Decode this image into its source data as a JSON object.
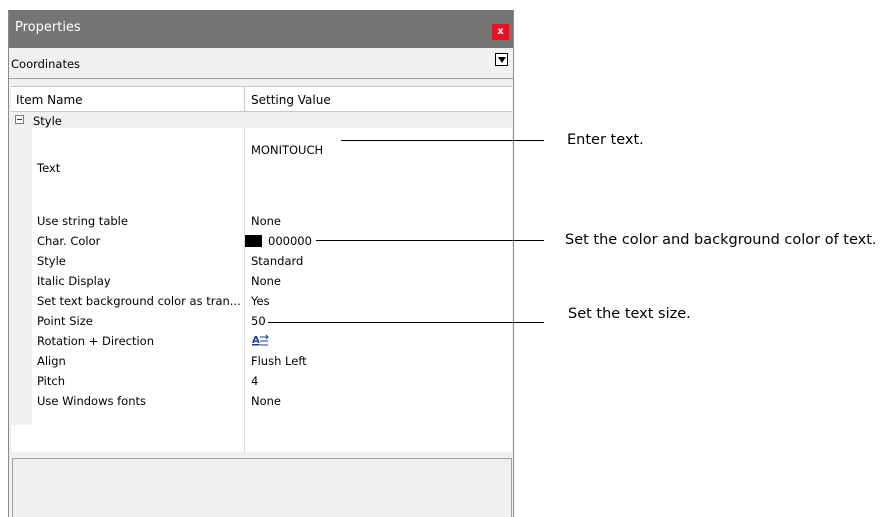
{
  "window": {
    "title": "Properties",
    "close_label": "x",
    "selector": "Coordinates"
  },
  "grid": {
    "headers": [
      "Item Name",
      "Setting Value"
    ],
    "category": "Style",
    "rows": [
      {
        "name": "Text",
        "value": "MONITOUCH"
      },
      {
        "name": "Use string table",
        "value": "None"
      },
      {
        "name": "Char. Color",
        "value": "000000",
        "swatch": "#000000"
      },
      {
        "name": "Style",
        "value": "Standard"
      },
      {
        "name": "Italic Display",
        "value": "None"
      },
      {
        "name": "Set text background color as tran...",
        "value": "Yes"
      },
      {
        "name": "Point Size",
        "value": "50"
      },
      {
        "name": "Rotation + Direction",
        "value": "",
        "icon": "text-direction-icon"
      },
      {
        "name": "Align",
        "value": "Flush Left"
      },
      {
        "name": "Pitch",
        "value": "4"
      },
      {
        "name": "Use Windows fonts",
        "value": "None"
      }
    ]
  },
  "callouts": [
    "Enter text.",
    "Set the color and background color of text.",
    "Set the text size."
  ],
  "colors": {
    "titlebar": "#757575",
    "close": "#e81123",
    "panel": "#f0f0f0"
  }
}
